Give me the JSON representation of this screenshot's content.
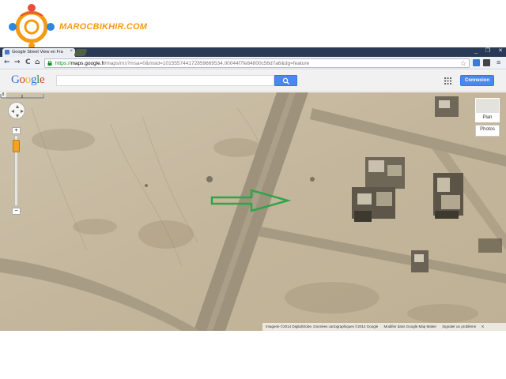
{
  "watermark": {
    "brand": "MAROCBIKHIR.COM"
  },
  "browser": {
    "tab_title": "Google Street View en Fra",
    "tab_close": "×",
    "window_controls": [
      "_",
      "❐",
      "✕"
    ],
    "nav_back": "←",
    "nav_forward": "→",
    "nav_reload": "C",
    "nav_home": "⌂",
    "url_scheme": "https://",
    "url_host": "maps.google.fr",
    "url_path": "/maps/ms?msa=0&msid=101555744172859669534.00044f7fe84800c56d7a6&dg=feature",
    "menu_glyph": "≡",
    "star_glyph": "☆"
  },
  "google_header": {
    "logo_letters": [
      "G",
      "o",
      "o",
      "g",
      "l",
      "e"
    ],
    "logo_colors": [
      "#3c6fd1",
      "#d2402e",
      "#f2b521",
      "#3c6fd1",
      "#2a9b3d",
      "#d2402e"
    ],
    "signin_label": "Connexion",
    "search_value": ""
  },
  "map": {
    "map_type_label": "Plan",
    "photos_label": "Photos",
    "zoom_in": "+",
    "zoom_out": "−",
    "corner_label": "8",
    "attribution": [
      "Imagerie ©2014 DigitalGlobe, Données cartographiques ©2014 Google",
      "Modifier dans Google Map Maker",
      "Signaler un problème"
    ],
    "attribution_suffix": "K",
    "annotation_arrow_color": "#2fa54a"
  }
}
